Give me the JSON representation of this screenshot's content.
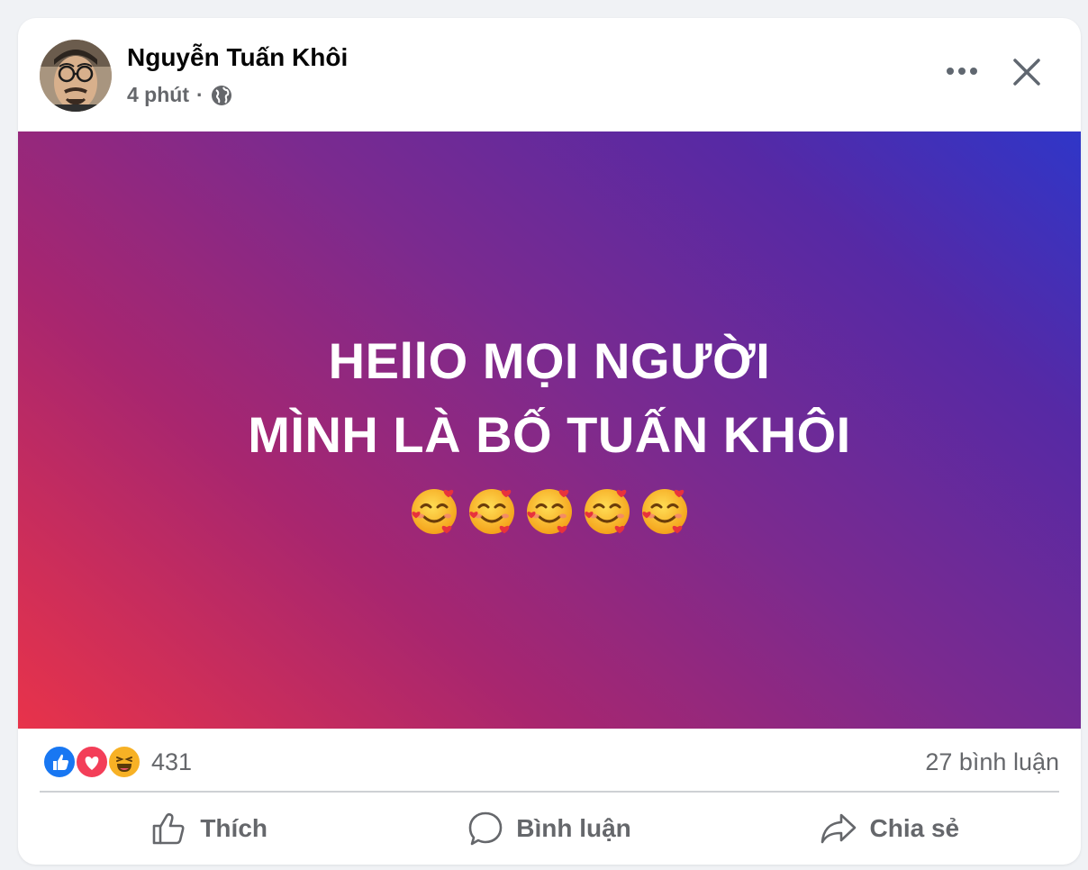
{
  "post": {
    "author_name": "Nguyễn Tuấn Khôi",
    "time": "4 phút",
    "separator": "·",
    "privacy_icon": "globe-icon",
    "more_icon": "more-dots-icon",
    "close_icon": "close-icon",
    "text_lines": [
      "HEllO MỌI NGƯỜI",
      "MÌNH LÀ BỐ TUẤN KHÔI"
    ],
    "emoji_name": "smiling-face-with-hearts",
    "emoji_count": 5,
    "background_colors": [
      "#e8334a",
      "#a8266f",
      "#7b2a8f",
      "#5629a5",
      "#2f36c8"
    ]
  },
  "stats": {
    "reaction_icons": [
      "like-icon",
      "love-icon",
      "haha-icon"
    ],
    "reaction_count": "431",
    "comment_count": "27 bình luận"
  },
  "actions": {
    "like_label": "Thích",
    "comment_label": "Bình luận",
    "share_label": "Chia sẻ"
  },
  "colors": {
    "like_blue": "#1877f2",
    "love_red": "#f33e58",
    "haha_yellow": "#f7b125",
    "text_secondary": "#65676b"
  }
}
